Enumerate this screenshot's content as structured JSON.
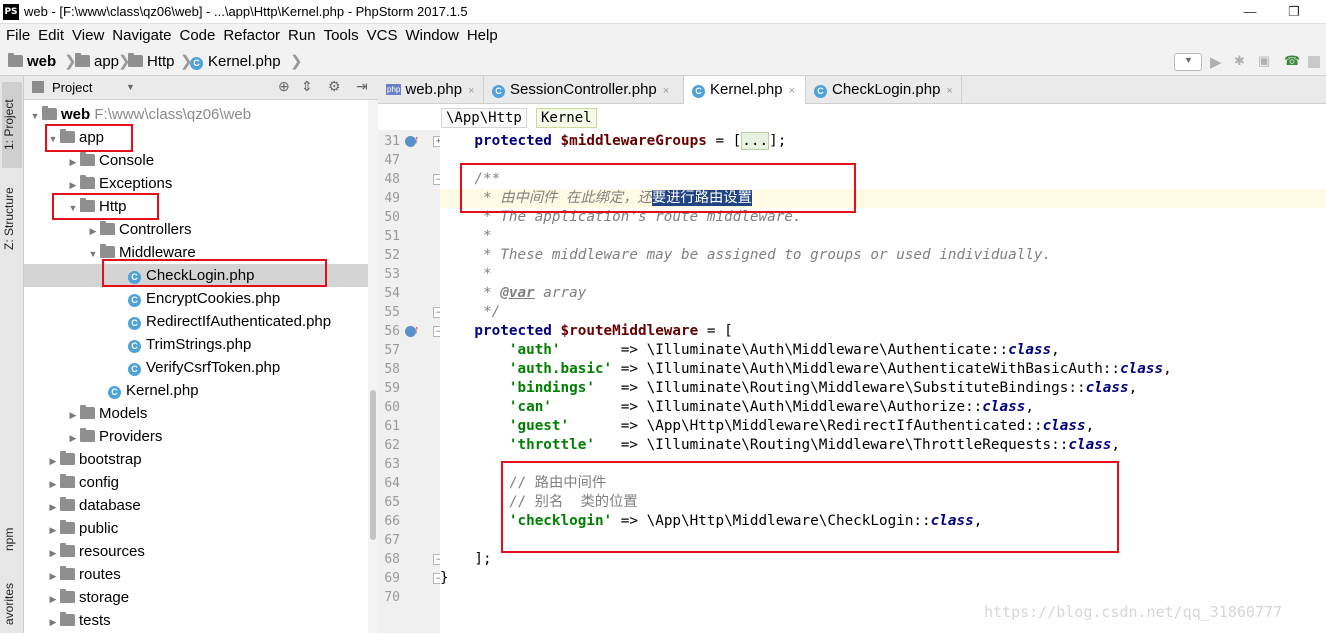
{
  "window": {
    "app_icon": "PS",
    "title": "web - [F:\\www\\class\\qz06\\web] - ...\\app\\Http\\Kernel.php - PhpStorm 2017.1.5",
    "minimize": "—",
    "restore": "❐"
  },
  "menu": [
    "File",
    "Edit",
    "View",
    "Navigate",
    "Code",
    "Refactor",
    "Run",
    "Tools",
    "VCS",
    "Window",
    "Help"
  ],
  "nav": {
    "crumbs": [
      "web",
      "app",
      "Http",
      "Kernel.php"
    ]
  },
  "left_strip": {
    "project": "1: Project",
    "structure": "Z: Structure",
    "npm": "npm",
    "favorites": "avorites"
  },
  "project_panel": {
    "header": "Project",
    "tree": [
      {
        "label": "web",
        "path": "F:\\www\\class\\qz06\\web",
        "type": "folder",
        "expanded": true
      },
      {
        "label": "app",
        "type": "folder",
        "expanded": true
      },
      {
        "label": "Console",
        "type": "folder",
        "expanded": false
      },
      {
        "label": "Exceptions",
        "type": "folder",
        "expanded": false
      },
      {
        "label": "Http",
        "type": "folder",
        "expanded": true
      },
      {
        "label": "Controllers",
        "type": "folder",
        "expanded": false
      },
      {
        "label": "Middleware",
        "type": "folder",
        "expanded": true
      },
      {
        "label": "CheckLogin.php",
        "type": "class",
        "selected": true
      },
      {
        "label": "EncryptCookies.php",
        "type": "class"
      },
      {
        "label": "RedirectIfAuthenticated.php",
        "type": "class"
      },
      {
        "label": "TrimStrings.php",
        "type": "class"
      },
      {
        "label": "VerifyCsrfToken.php",
        "type": "class"
      },
      {
        "label": "Kernel.php",
        "type": "class"
      },
      {
        "label": "Models",
        "type": "folder",
        "expanded": false
      },
      {
        "label": "Providers",
        "type": "folder",
        "expanded": false
      },
      {
        "label": "bootstrap",
        "type": "folder",
        "expanded": false
      },
      {
        "label": "config",
        "type": "folder",
        "expanded": false
      },
      {
        "label": "database",
        "type": "folder",
        "expanded": false
      },
      {
        "label": "public",
        "type": "folder",
        "expanded": false
      },
      {
        "label": "resources",
        "type": "folder",
        "expanded": false
      },
      {
        "label": "routes",
        "type": "folder",
        "expanded": false
      },
      {
        "label": "storage",
        "type": "folder",
        "expanded": false
      },
      {
        "label": "tests",
        "type": "folder",
        "expanded": false
      }
    ]
  },
  "editor": {
    "tabs": [
      {
        "label": "web.php",
        "icon": "php-file-icon",
        "active": false
      },
      {
        "label": "SessionController.php",
        "icon": "class-icon",
        "active": false
      },
      {
        "label": "Kernel.php",
        "icon": "class-icon",
        "active": true
      },
      {
        "label": "CheckLogin.php",
        "icon": "class-icon",
        "active": false
      }
    ],
    "close_glyph": "×",
    "breadcrumb": [
      "\\App\\Http",
      "Kernel"
    ],
    "lines": [
      {
        "n": "31",
        "text": "    protected $middlewareGroups = [...];"
      },
      {
        "n": "47",
        "text": ""
      },
      {
        "n": "48",
        "text": "    /**"
      },
      {
        "n": "49",
        "text": "     * 由中间件 在此绑定，还要进行路由设置"
      },
      {
        "n": "50",
        "text": "     * The application's route middleware."
      },
      {
        "n": "51",
        "text": "     *"
      },
      {
        "n": "52",
        "text": "     * These middleware may be assigned to groups or used individually."
      },
      {
        "n": "53",
        "text": "     *"
      },
      {
        "n": "54",
        "text": "     * @var array"
      },
      {
        "n": "55",
        "text": "     */"
      },
      {
        "n": "56",
        "text": "    protected $routeMiddleware = ["
      },
      {
        "n": "57",
        "text": "        'auth'       => \\Illuminate\\Auth\\Middleware\\Authenticate::class,"
      },
      {
        "n": "58",
        "text": "        'auth.basic' => \\Illuminate\\Auth\\Middleware\\AuthenticateWithBasicAuth::class,"
      },
      {
        "n": "59",
        "text": "        'bindings'   => \\Illuminate\\Routing\\Middleware\\SubstituteBindings::class,"
      },
      {
        "n": "60",
        "text": "        'can'        => \\Illuminate\\Auth\\Middleware\\Authorize::class,"
      },
      {
        "n": "61",
        "text": "        'guest'      => \\App\\Http\\Middleware\\RedirectIfAuthenticated::class,"
      },
      {
        "n": "62",
        "text": "        'throttle'   => \\Illuminate\\Routing\\Middleware\\ThrottleRequests::class,"
      },
      {
        "n": "63",
        "text": ""
      },
      {
        "n": "64",
        "text": "        // 路由中间件"
      },
      {
        "n": "65",
        "text": "        // 别名  类的位置"
      },
      {
        "n": "66",
        "text": "        'checklogin' => \\App\\Http\\Middleware\\CheckLogin::class,"
      },
      {
        "n": "67",
        "text": ""
      },
      {
        "n": "68",
        "text": "    ];"
      },
      {
        "n": "69",
        "text": "}"
      },
      {
        "n": "70",
        "text": ""
      }
    ]
  },
  "watermark": "https://blog.csdn.net/qq_31860777",
  "colors": {
    "annotation_red": "#e3101c",
    "keyword": "#000080",
    "string": "#008000",
    "comment": "#808080",
    "variable": "#660000",
    "selection": "#214283"
  }
}
